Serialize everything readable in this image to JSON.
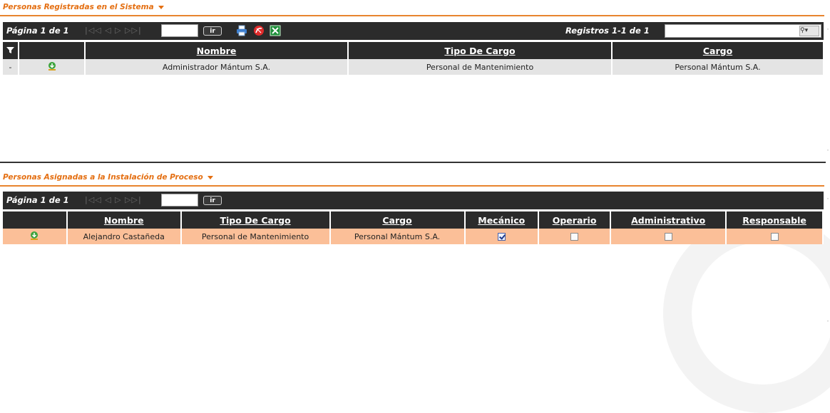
{
  "top_panel": {
    "title": "Personas Registradas en el Sistema",
    "pager": "Página 1 de 1",
    "nav_glyphs": "|◁◁ ◁  ▷ ▷▷|",
    "go_label": "ir",
    "records_label": "Registros 1-1 de 1",
    "search_value": "",
    "columns": [
      "Nombre",
      "Tipo De Cargo",
      "Cargo"
    ],
    "rows": [
      {
        "marker": "-",
        "nombre": "Administrador Mántum S.A.",
        "tipo": "Personal de Mantenimiento",
        "cargo": "Personal Mántum S.A."
      }
    ]
  },
  "bottom_panel": {
    "title": "Personas Asignadas a la Instalación de Proceso",
    "pager": "Página 1 de 1",
    "nav_glyphs": "|◁◁ ◁  ▷ ▷▷|",
    "go_label": "ir",
    "columns": [
      "Nombre",
      "Tipo De Cargo",
      "Cargo",
      "Mecánico",
      "Operario",
      "Administrativo",
      "Responsable"
    ],
    "rows": [
      {
        "nombre": "Alejandro Castañeda",
        "tipo": "Personal de Mantenimiento",
        "cargo": "Personal Mántum S.A.",
        "mecanico": true,
        "operario": false,
        "administrativo": false,
        "responsable": false
      }
    ]
  },
  "icons": [
    "filter-icon",
    "download-icon",
    "print-icon",
    "pdf-icon",
    "excel-icon",
    "search-icon"
  ],
  "colors": {
    "accent": "#e46f12",
    "toolbar": "#2b2b2b",
    "row_gray": "#e4e4e4",
    "row_highlight": "#fbbf98"
  }
}
